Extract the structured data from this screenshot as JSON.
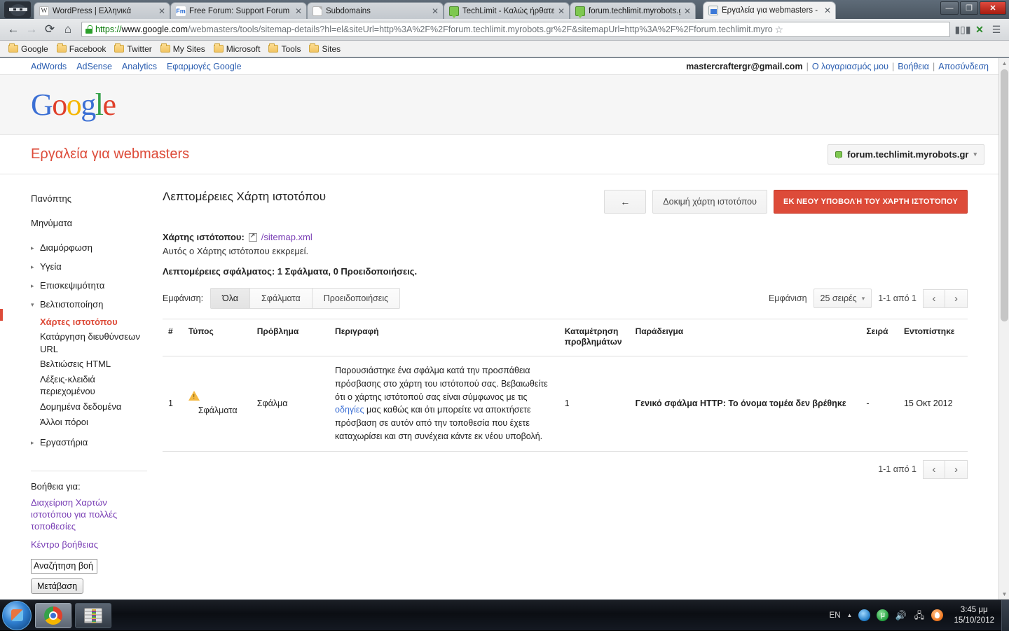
{
  "browser": {
    "tabs": [
      {
        "title": "WordPress | Ελληνικά",
        "favicon": "wordpress-icon",
        "active": false
      },
      {
        "title": "Free Forum: Support Forum",
        "favicon": "forumotion-icon",
        "active": false
      },
      {
        "title": "Subdomains",
        "favicon": "document-icon",
        "active": false
      },
      {
        "title": "TechLimit - Καλώς ήρθατε",
        "favicon": "green-chat-icon",
        "active": false
      },
      {
        "title": "forum.techlimit.myrobots.gr",
        "favicon": "green-chat-icon",
        "active": false
      },
      {
        "title": "Εργαλεία για webmasters -",
        "favicon": "webmaster-tools-icon",
        "active": true
      }
    ],
    "tab_close_label": "✕",
    "window_controls": {
      "minimize": "—",
      "maximize": "❐",
      "close": "✕"
    },
    "nav": {
      "back": "←",
      "forward": "→",
      "reload": "⟳",
      "home": "⌂"
    },
    "url": {
      "scheme": "https://",
      "host": "www.google.com",
      "rest": "/webmasters/tools/sitemap-details?hl=el&siteUrl=http%3A%2F%2Fforum.techlimit.myrobots.gr%2F&sitemapUrl=http%3A%2F%2Fforum.techlimit.myro",
      "lock": "lock-icon",
      "star": "☆"
    },
    "toolbar_icons": [
      "analytics-icon",
      "extension-icon",
      "menu-icon"
    ],
    "bookmarks": [
      {
        "label": "Google"
      },
      {
        "label": "Facebook"
      },
      {
        "label": "Twitter"
      },
      {
        "label": "My Sites"
      },
      {
        "label": "Microsoft"
      },
      {
        "label": "Tools"
      },
      {
        "label": "Sites"
      }
    ]
  },
  "gbar": {
    "links": [
      "AdWords",
      "AdSense",
      "Analytics",
      "Εφαρμογές Google"
    ],
    "user_email": "mastercraftergr@gmail.com",
    "account_link": "Ο λογαριασμός μου",
    "help_link": "Βοήθεια",
    "signout_link": "Αποσύνδεση",
    "separator": "|"
  },
  "logo": {
    "parts": [
      {
        "ch": "G",
        "color": "#3b6fd4"
      },
      {
        "ch": "o",
        "color": "#e0402b"
      },
      {
        "ch": "o",
        "color": "#f5b600"
      },
      {
        "ch": "g",
        "color": "#3b6fd4"
      },
      {
        "ch": "l",
        "color": "#35a14a"
      },
      {
        "ch": "e",
        "color": "#e0402b"
      }
    ]
  },
  "header": {
    "product_title": "Εργαλεία για webmasters",
    "product_title_color": "#dd4b39",
    "site_selector": {
      "label": "forum.techlimit.myrobots.gr",
      "caret": "▾",
      "icon": "site-icon"
    }
  },
  "sidebar": {
    "items": [
      {
        "label": "Πανόπτης",
        "arrow": "",
        "level": "top"
      },
      {
        "label": "Μηνύματα",
        "arrow": "",
        "level": "top"
      },
      {
        "label": "Διαμόρφωση",
        "arrow": "▸",
        "level": "group"
      },
      {
        "label": "Υγεία",
        "arrow": "▸",
        "level": "group"
      },
      {
        "label": "Επισκεψιμότητα",
        "arrow": "▸",
        "level": "group"
      },
      {
        "label": "Βελτιστοποίηση",
        "arrow": "▾",
        "level": "group",
        "expanded": true
      }
    ],
    "sub_items": [
      {
        "label": "Χάρτες ιστοτόπου",
        "active": true
      },
      {
        "label": "Κατάργηση διευθύνσεων URL",
        "active": false
      },
      {
        "label": "Βελτιώσεις HTML",
        "active": false
      },
      {
        "label": "Λέξεις-κλειδιά περιεχομένου",
        "active": false
      },
      {
        "label": "Δομημένα δεδομένα",
        "active": false
      },
      {
        "label": "Άλλοι πόροι",
        "active": false
      }
    ],
    "last_group": {
      "label": "Εργαστήρια",
      "arrow": "▸"
    },
    "help": {
      "heading": "Βοήθεια για:",
      "link1": "Διαχείριση Χαρτών ιστοτόπου για πολλές τοποθεσίες",
      "link2": "Κέντρο βοήθειας",
      "search_value": "Αναζήτηση βοή",
      "search_placeholder": "Αναζήτηση βοήθειας",
      "go_button": "Μετάβαση"
    }
  },
  "main": {
    "page_title": "Λεπτομέρειες Χάρτη ιστοτόπου",
    "actions": {
      "back": "←",
      "test": "Δοκιμή χάρτη ιστοτόπου",
      "resubmit": "ΕΚ ΝΕΟΥ ΥΠΟΒΟΛΉ ΤΟΥ ΧΆΡΤΗ ΙΣΤΟΤΌΠΟΥ",
      "resubmit_color": "#dd4b39"
    },
    "sitemap": {
      "label": "Χάρτης ιστότοπου:",
      "link": "/sitemap.xml",
      "ext_icon": "external-link-icon",
      "status": "Αυτός ο Χάρτης ιστότοπου εκκρεμεί.",
      "error_summary": "Λεπτομέρειες σφάλματος: 1 Σφάλματα, 0 Προειδοποιήσεις."
    },
    "filter": {
      "label": "Εμφάνιση:",
      "options": [
        {
          "label": "Όλα",
          "selected": true
        },
        {
          "label": "Σφάλματα",
          "selected": false
        },
        {
          "label": "Προειδοποιήσεις",
          "selected": false
        }
      ]
    },
    "pager": {
      "show_label": "Εμφάνιση",
      "rows_value": "25 σειρές",
      "rows_caret": "▾",
      "range": "1-1 από 1",
      "prev": "‹",
      "next": "›"
    },
    "table": {
      "headers": [
        "#",
        "Τύπος",
        "Πρόβλημα",
        "Περιγραφή",
        "Καταμέτρηση προβλημάτων",
        "Παράδειγμα",
        "Σειρά",
        "Εντοπίστηκε"
      ],
      "rows": [
        {
          "num": "1",
          "type_icon": "warning-triangle-icon",
          "type": "Σφάλματα",
          "problem": "Σφάλμα",
          "desc_before": "Παρουσιάστηκε ένα σφάλμα κατά την προσπάθεια πρόσβασης στο χάρτη του ιστότοπού σας. Βεβαιωθείτε ότι ο χάρτης ιστότοπού σας είναι σύμφωνος με τις ",
          "desc_link": "οδηγίες",
          "desc_after": " μας καθώς και ότι μπορείτε να αποκτήσετε πρόσβαση σε αυτόν από την τοποθεσία που έχετε καταχωρίσει και στη συνέχεια κάντε εκ νέου υποβολή.",
          "count": "1",
          "example": "Γενικό σφάλμα HTTP: Το όνομα τομέα δεν βρέθηκε",
          "line": "-",
          "detected": "15 Οκτ 2012"
        }
      ]
    }
  },
  "taskbar": {
    "start": "start-orb",
    "tasks": [
      {
        "icon": "chrome-icon",
        "active": true
      },
      {
        "icon": "winrar-icon",
        "active": false
      }
    ],
    "tray": {
      "language": "EN",
      "expand": "▲",
      "icons": [
        "internet-explorer-icon",
        "utorrent-icon",
        "volume-icon",
        "network-icon",
        "updater-icon"
      ],
      "time": "3:45 μμ",
      "date": "15/10/2012"
    }
  }
}
